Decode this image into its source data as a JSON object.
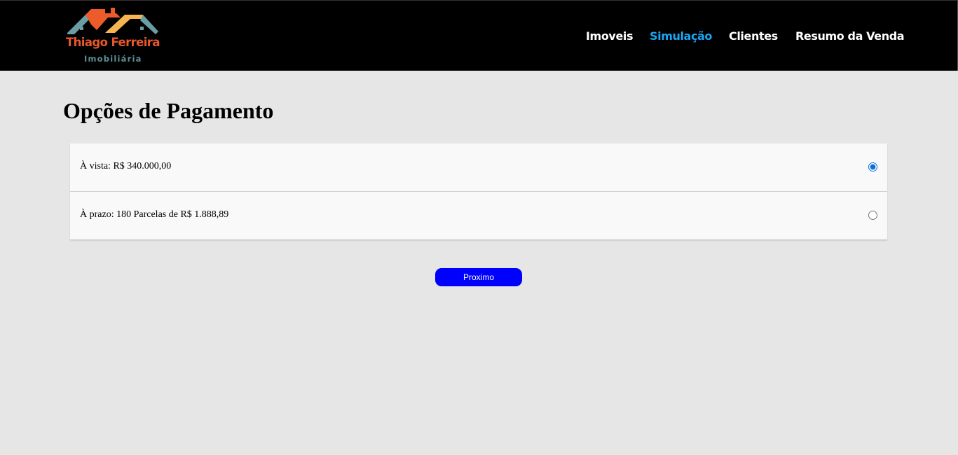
{
  "brand": {
    "name": "Thiago Ferreira",
    "subtitle": "Imobiliária",
    "colors": {
      "name": "#e8582a",
      "subtitle": "#5f8f96",
      "roof_orange": "#ee5b2b",
      "roof_yellow": "#f6b552",
      "roof_teal": "#6a9ea3"
    }
  },
  "nav": {
    "items": [
      {
        "label": "Imoveis",
        "active": false
      },
      {
        "label": "Simulação",
        "active": true
      },
      {
        "label": "Clientes",
        "active": false
      },
      {
        "label": "Resumo da Venda",
        "active": false
      }
    ],
    "colors": {
      "default": "#ffffff",
      "active": "#1ba6f2"
    }
  },
  "page": {
    "title": "Opções de Pagamento"
  },
  "payment_options": [
    {
      "label": "À vista: R$ 340.000,00",
      "selected": true
    },
    {
      "label": "À prazo: 180 Parcelas de R$ 1.888,89",
      "selected": false
    }
  ],
  "actions": {
    "next_label": "Proximo",
    "next_color": "#0000ff"
  }
}
